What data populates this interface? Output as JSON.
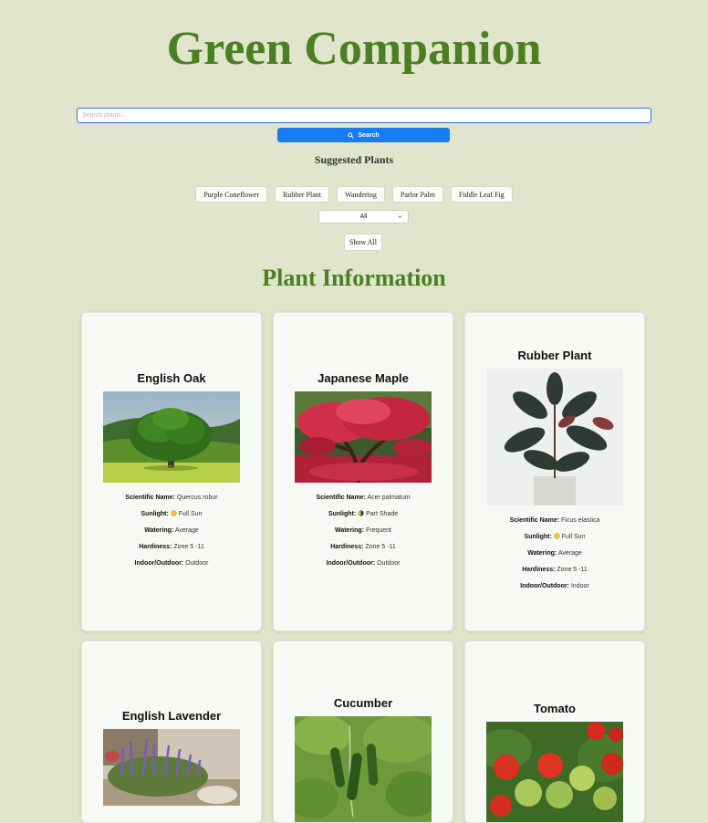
{
  "app": {
    "title": "Green Companion"
  },
  "search": {
    "placeholder": "Search plants...",
    "button_label": "Search"
  },
  "suggested": {
    "heading": "Suggested Plants",
    "chips": [
      "Purple Coneflower",
      "Rubber Plant",
      "Wandering",
      "Parlor Palm",
      "Fiddle Leaf Fig"
    ]
  },
  "filter": {
    "selected": "All"
  },
  "show_all_label": "Show All",
  "section_title": "Plant Information",
  "labels": {
    "scientific": "Scientific Name:",
    "sunlight": "Sunlight:",
    "watering": "Watering:",
    "hardiness": "Hardiness:",
    "location": "Indoor/Outdoor:"
  },
  "plants": [
    {
      "name": "English Oak",
      "scientific": "Quercus robur",
      "sun_icon": "sun-icon",
      "sunlight": "Full Sun",
      "watering": "Average",
      "hardiness": "Zone 5 -11",
      "location": "Outdoor"
    },
    {
      "name": "Japanese Maple",
      "scientific": "Acer palmatum",
      "sun_icon": "half-sun-icon",
      "sunlight": "Part Shade",
      "watering": "Frequent",
      "hardiness": "Zone 5 -11",
      "location": "Outdoor"
    },
    {
      "name": "Rubber Plant",
      "scientific": "Ficus elastica",
      "sun_icon": "sun-icon",
      "sunlight": "Full Sun",
      "watering": "Average",
      "hardiness": "Zone 5 -11",
      "location": "Indoor"
    },
    {
      "name": "English Lavender"
    },
    {
      "name": "Cucumber"
    },
    {
      "name": "Tomato"
    }
  ],
  "colors": {
    "background": "#e0e5cc",
    "heading": "#4a7f22",
    "accent": "#1a7cf5",
    "card": "#f7f9f5"
  }
}
